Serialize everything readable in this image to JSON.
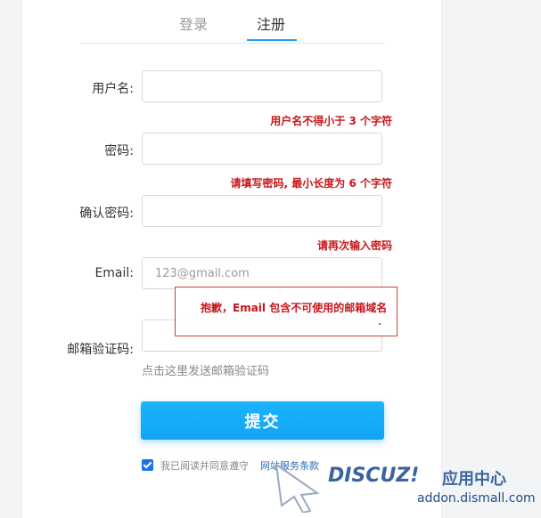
{
  "tabs": {
    "login": "登录",
    "register": "注册"
  },
  "form": {
    "username_label": "用户名:",
    "username_error": "用户名不得小于 3 个字符",
    "password_label": "密码:",
    "password_error": "请填写密码, 最小长度为 6 个字符",
    "confirm_label": "确认密码:",
    "confirm_error": "请再次输入密码",
    "email_label": "Email:",
    "email_placeholder": "123@gmail.com",
    "email_error_popup": "抱歉，Email 包含不可使用的邮箱域名",
    "code_label": "邮箱验证码:",
    "send_code_link": "点击这里发送邮箱验证码",
    "submit_label": "提交",
    "agree_text": "我已阅读并同意遵守",
    "agree_link": "网站服务条款"
  },
  "watermark": {
    "brand": "DISCUZ!",
    "cn": "应用中心",
    "url": "addon.dismall.com"
  },
  "colors": {
    "accent": "#1e9fff",
    "error": "#c7161b",
    "submit": "#12a4f5"
  }
}
